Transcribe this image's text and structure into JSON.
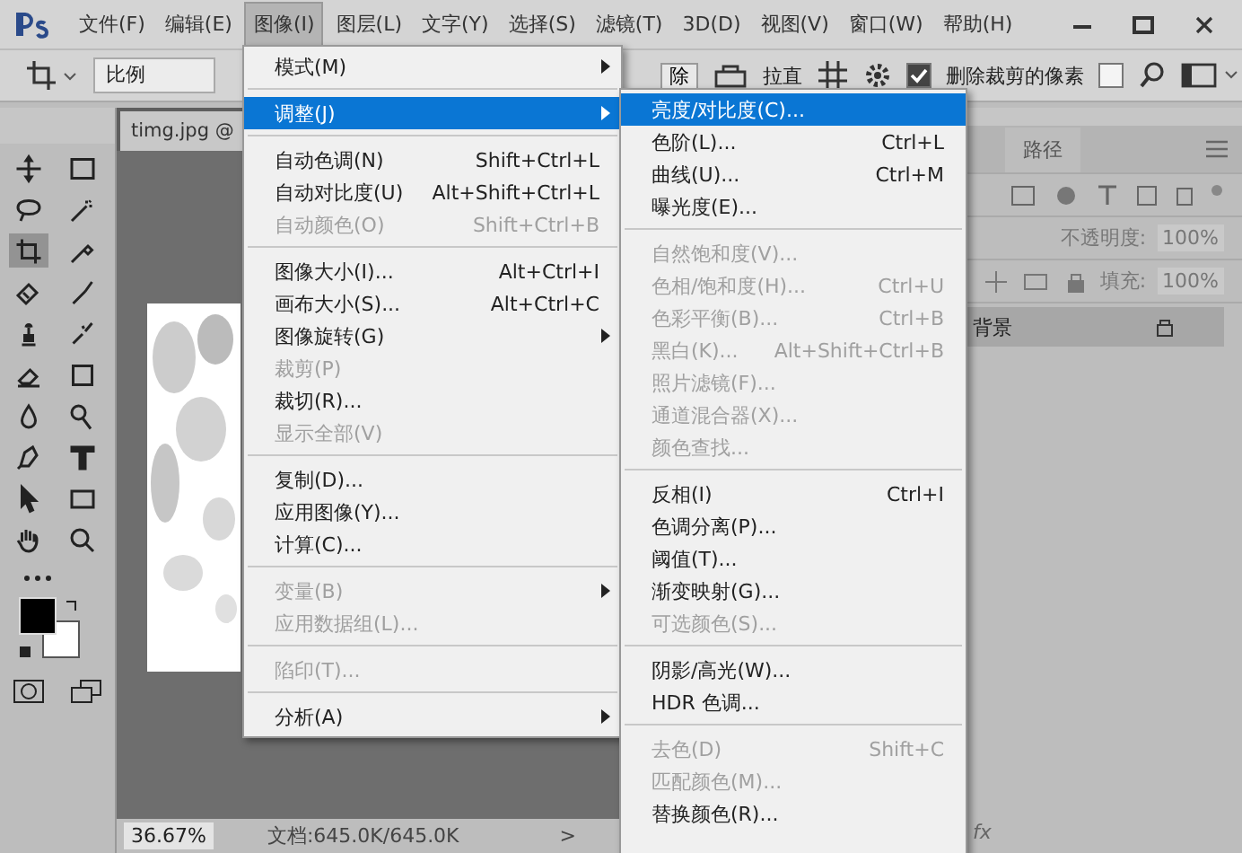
{
  "menu_bar": {
    "items": [
      {
        "label": "文件(F)",
        "selected": false
      },
      {
        "label": "编辑(E)",
        "selected": false
      },
      {
        "label": "图像(I)",
        "selected": true
      },
      {
        "label": "图层(L)",
        "selected": false
      },
      {
        "label": "文字(Y)",
        "selected": false
      },
      {
        "label": "选择(S)",
        "selected": false
      },
      {
        "label": "滤镜(T)",
        "selected": false
      },
      {
        "label": "3D(D)",
        "selected": false
      },
      {
        "label": "视图(V)",
        "selected": false
      },
      {
        "label": "窗口(W)",
        "selected": false
      },
      {
        "label": "帮助(H)",
        "selected": false
      }
    ]
  },
  "options_bar": {
    "ratio_field": "比例",
    "clear_button": "除",
    "straighten_label": "拉直",
    "delete_cropped": {
      "label": "删除裁剪的像素",
      "checked": true
    },
    "content_aware": {
      "checked": false
    }
  },
  "toolbox": {
    "tools": [
      {
        "selected": false
      },
      {
        "selected": false
      },
      {
        "selected": false
      },
      {
        "selected": false
      },
      {
        "selected": true
      },
      {
        "selected": false
      },
      {
        "selected": false
      },
      {
        "selected": false
      },
      {
        "selected": false
      },
      {
        "selected": false
      },
      {
        "selected": false
      },
      {
        "selected": false
      },
      {
        "selected": false
      },
      {
        "selected": false
      },
      {
        "selected": false
      },
      {
        "selected": false
      },
      {
        "selected": false
      },
      {
        "selected": false
      },
      {
        "selected": false
      },
      {
        "selected": false
      }
    ]
  },
  "document_tab": {
    "title": "timg.jpg @"
  },
  "status_bar": {
    "zoom": "36.67%",
    "document_info": "文档:645.0K/645.0K",
    "arrow": ">"
  },
  "layers_panel": {
    "tab": "路径",
    "opacity_label": "不透明度:",
    "opacity": "100%",
    "fill_label": "填充:",
    "fill": "100%",
    "layers": [
      {
        "name": "背景",
        "locked": true
      }
    ],
    "footer_fx": "fx"
  },
  "image_menu": {
    "items": [
      {
        "kind": "item",
        "label": "模式(M)",
        "submenu": true,
        "disabled": false,
        "selected": false
      },
      {
        "kind": "separator"
      },
      {
        "kind": "item",
        "label": "调整(J)",
        "submenu": true,
        "disabled": false,
        "selected": true
      },
      {
        "kind": "separator"
      },
      {
        "kind": "item",
        "label": "自动色调(N)",
        "shortcut": "Shift+Ctrl+L",
        "disabled": false,
        "selected": false
      },
      {
        "kind": "item",
        "label": "自动对比度(U)",
        "shortcut": "Alt+Shift+Ctrl+L",
        "disabled": false,
        "selected": false
      },
      {
        "kind": "item",
        "label": "自动颜色(O)",
        "shortcut": "Shift+Ctrl+B",
        "disabled": true,
        "selected": false
      },
      {
        "kind": "separator"
      },
      {
        "kind": "item",
        "label": "图像大小(I)...",
        "shortcut": "Alt+Ctrl+I",
        "disabled": false,
        "selected": false
      },
      {
        "kind": "item",
        "label": "画布大小(S)...",
        "shortcut": "Alt+Ctrl+C",
        "disabled": false,
        "selected": false
      },
      {
        "kind": "item",
        "label": "图像旋转(G)",
        "submenu": true,
        "disabled": false,
        "selected": false
      },
      {
        "kind": "item",
        "label": "裁剪(P)",
        "disabled": true,
        "selected": false
      },
      {
        "kind": "item",
        "label": "裁切(R)...",
        "disabled": false,
        "selected": false
      },
      {
        "kind": "item",
        "label": "显示全部(V)",
        "disabled": true,
        "selected": false
      },
      {
        "kind": "separator"
      },
      {
        "kind": "item",
        "label": "复制(D)...",
        "disabled": false,
        "selected": false
      },
      {
        "kind": "item",
        "label": "应用图像(Y)...",
        "disabled": false,
        "selected": false
      },
      {
        "kind": "item",
        "label": "计算(C)...",
        "disabled": false,
        "selected": false
      },
      {
        "kind": "separator"
      },
      {
        "kind": "item",
        "label": "变量(B)",
        "submenu": true,
        "disabled": true,
        "selected": false
      },
      {
        "kind": "item",
        "label": "应用数据组(L)...",
        "disabled": true,
        "selected": false
      },
      {
        "kind": "separator"
      },
      {
        "kind": "item",
        "label": "陷印(T)...",
        "disabled": true,
        "selected": false
      },
      {
        "kind": "separator"
      },
      {
        "kind": "item",
        "label": "分析(A)",
        "submenu": true,
        "disabled": false,
        "selected": false
      }
    ]
  },
  "adjustments_submenu": {
    "items": [
      {
        "kind": "item",
        "label": "亮度/对比度(C)...",
        "disabled": false,
        "selected": true
      },
      {
        "kind": "item",
        "label": "色阶(L)...",
        "shortcut": "Ctrl+L",
        "disabled": false,
        "selected": false
      },
      {
        "kind": "item",
        "label": "曲线(U)...",
        "shortcut": "Ctrl+M",
        "disabled": false,
        "selected": false
      },
      {
        "kind": "item",
        "label": "曝光度(E)...",
        "disabled": false,
        "selected": false
      },
      {
        "kind": "separator"
      },
      {
        "kind": "item",
        "label": "自然饱和度(V)...",
        "disabled": true,
        "selected": false
      },
      {
        "kind": "item",
        "label": "色相/饱和度(H)...",
        "shortcut": "Ctrl+U",
        "disabled": true,
        "selected": false
      },
      {
        "kind": "item",
        "label": "色彩平衡(B)...",
        "shortcut": "Ctrl+B",
        "disabled": true,
        "selected": false
      },
      {
        "kind": "item",
        "label": "黑白(K)...",
        "shortcut": "Alt+Shift+Ctrl+B",
        "disabled": true,
        "selected": false
      },
      {
        "kind": "item",
        "label": "照片滤镜(F)...",
        "disabled": true,
        "selected": false
      },
      {
        "kind": "item",
        "label": "通道混合器(X)...",
        "disabled": true,
        "selected": false
      },
      {
        "kind": "item",
        "label": "颜色查找...",
        "disabled": true,
        "selected": false
      },
      {
        "kind": "separator"
      },
      {
        "kind": "item",
        "label": "反相(I)",
        "shortcut": "Ctrl+I",
        "disabled": false,
        "selected": false
      },
      {
        "kind": "item",
        "label": "色调分离(P)...",
        "disabled": false,
        "selected": false
      },
      {
        "kind": "item",
        "label": "阈值(T)...",
        "disabled": false,
        "selected": false
      },
      {
        "kind": "item",
        "label": "渐变映射(G)...",
        "disabled": false,
        "selected": false
      },
      {
        "kind": "item",
        "label": "可选颜色(S)...",
        "disabled": true,
        "selected": false
      },
      {
        "kind": "separator"
      },
      {
        "kind": "item",
        "label": "阴影/高光(W)...",
        "disabled": false,
        "selected": false
      },
      {
        "kind": "item",
        "label": "HDR 色调...",
        "disabled": false,
        "selected": false
      },
      {
        "kind": "separator"
      },
      {
        "kind": "item",
        "label": "去色(D)",
        "shortcut": "Shift+C",
        "disabled": true,
        "selected": false
      },
      {
        "kind": "item",
        "label": "匹配颜色(M)...",
        "disabled": true,
        "selected": false
      },
      {
        "kind": "item",
        "label": "替换颜色(R)...",
        "disabled": false,
        "selected": false
      }
    ]
  }
}
